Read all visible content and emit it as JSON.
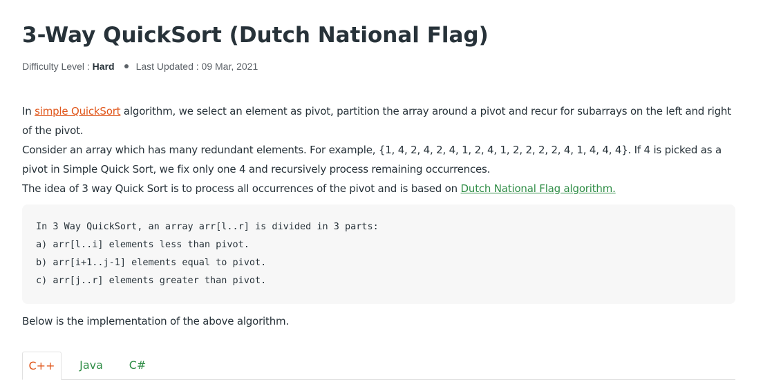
{
  "article": {
    "title": "3-Way QuickSort (Dutch National Flag)",
    "meta": {
      "difficulty_label": "Difficulty Level : ",
      "difficulty_value": "Hard",
      "updated_label": "Last Updated : ",
      "updated_value": "09 Mar, 2021"
    },
    "para1": {
      "prefix": "In ",
      "link": "simple QuickSort",
      "suffix": " algorithm, we select an element as pivot, partition the array around a pivot and recur for subarrays on the left and right of the pivot."
    },
    "para2": "Consider an array which has many redundant elements. For example, {1, 4, 2, 4, 2, 4, 1, 2, 4, 1, 2, 2, 2, 2, 4, 1, 4, 4, 4}. If 4 is picked as a pivot in Simple Quick Sort, we fix only one 4 and recursively process remaining occurrences.",
    "para3": {
      "prefix": "The idea of 3 way Quick Sort is to process all occurrences of the pivot and is based on ",
      "link": "Dutch National Flag algorithm."
    },
    "code_lines": [
      "In 3 Way QuickSort, an array arr[l..r] is divided in 3 parts:",
      "a) arr[l..i] elements less than pivot.",
      "b) arr[i+1..j-1] elements equal to pivot.",
      "c) arr[j..r] elements greater than pivot."
    ],
    "after_code": "Below is the implementation of the above algorithm.",
    "tabs": [
      {
        "label": "C++",
        "active": true
      },
      {
        "label": "Java",
        "active": false
      },
      {
        "label": "C#",
        "active": false
      }
    ]
  },
  "colors": {
    "text": "#273239",
    "link_orange": "#e0561b",
    "link_green": "#2f8d46",
    "code_bg": "#f7f7f7"
  }
}
